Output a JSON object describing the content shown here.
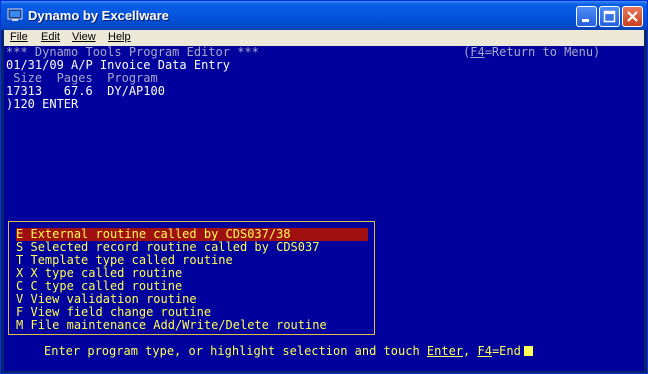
{
  "window": {
    "title": "Dynamo by Excellware"
  },
  "menubar": {
    "items": [
      "File",
      "Edit",
      "View",
      "Help"
    ]
  },
  "header": {
    "title_line": "*** Dynamo Tools Program Editor ***",
    "return_key": "F4",
    "return_label": "=Return to Menu)",
    "return_prefix": "(",
    "date_line": "01/31/09 A/P Invoice Data Entry",
    "columns_line": " Size  Pages  Program",
    "values_line": "17313   67.6  DY/AP100",
    "command_line": ")120 ENTER"
  },
  "options": [
    {
      "key": "E",
      "label": "External routine called by CDS037/38",
      "selected": true
    },
    {
      "key": "S",
      "label": "Selected record routine called by CDS037",
      "selected": false
    },
    {
      "key": "T",
      "label": "Template type called routine",
      "selected": false
    },
    {
      "key": "X",
      "label": "X type called routine",
      "selected": false
    },
    {
      "key": "C",
      "label": "C type called routine",
      "selected": false
    },
    {
      "key": "V",
      "label": "View validation routine",
      "selected": false
    },
    {
      "key": "F",
      "label": "View field change routine",
      "selected": false
    },
    {
      "key": "M",
      "label": "File maintenance Add/Write/Delete routine",
      "selected": false
    }
  ],
  "prompt": {
    "text": "Enter program type, or highlight selection and touch ",
    "enter_key": "Enter",
    "sep": ", ",
    "end_key": "F4",
    "end_label": "=End"
  },
  "colors": {
    "screen": "#00009c",
    "selected": "#a01010",
    "yellow": "#ffff55",
    "border": "#e0c040"
  }
}
